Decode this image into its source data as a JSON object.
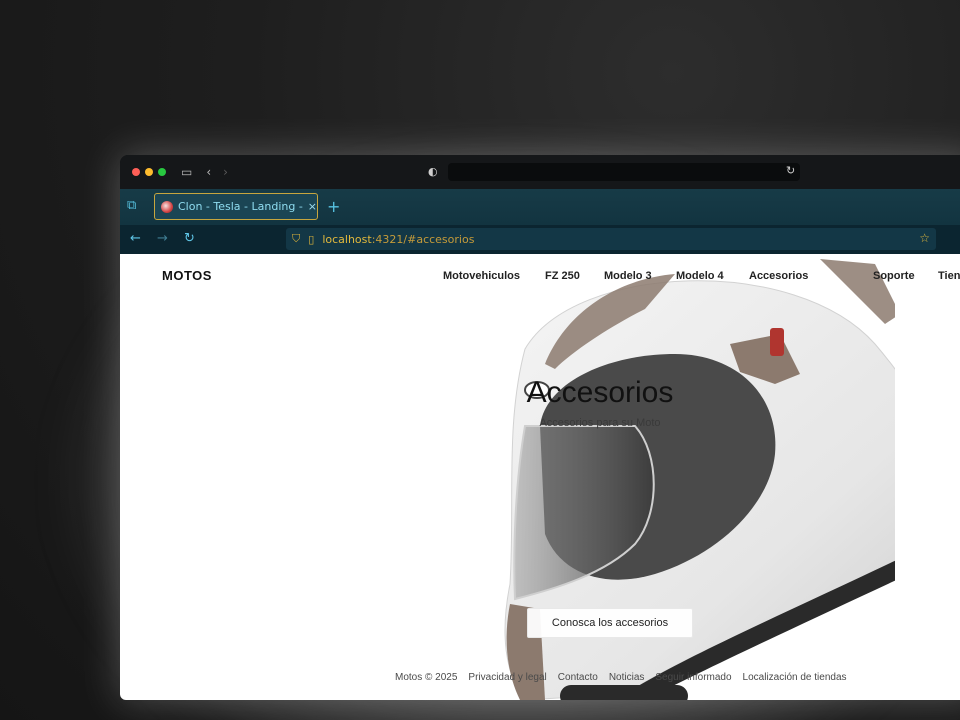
{
  "browser": {
    "tab_title": "Clon - Tesla - Landing - Motos",
    "tab_close": "×",
    "new_tab": "+",
    "address": {
      "host": "localhost",
      "path": ":4321/#accesorios"
    },
    "colors": {
      "accent": "#57c3e2",
      "tab_border": "#c7a63e",
      "url_text": "#e2b93c"
    }
  },
  "site": {
    "brand": "MOTOS",
    "nav": [
      "Motovehiculos",
      "FZ 250",
      "Modelo 3",
      "Modelo 4",
      "Accesorios"
    ],
    "nav_right": [
      "Soporte",
      "Tien"
    ],
    "hero": {
      "title": "Accesorios",
      "subtitle": "Accesorios para su Moto",
      "cta": "Conosca los accesorios"
    },
    "footer": [
      "Motos © 2025",
      "Privacidad y legal",
      "Contacto",
      "Noticias",
      "Seguir informado",
      "Localización de tiendas"
    ]
  },
  "icons": {
    "window_controls": [
      "close-dot",
      "minimize-dot",
      "zoom-dot"
    ],
    "toolbar": [
      "sidebar-icon",
      "back-icon",
      "forward-icon",
      "shield-icon",
      "reload-icon",
      "tabs-icon",
      "star-icon"
    ]
  }
}
